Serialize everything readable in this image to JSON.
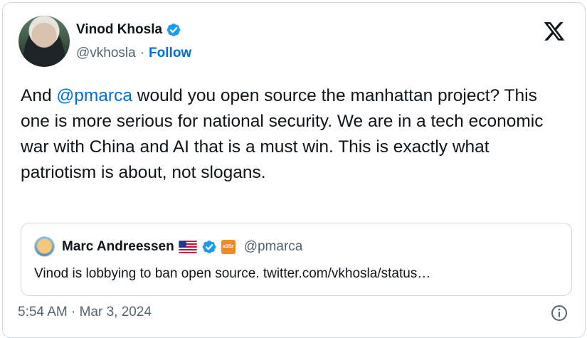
{
  "author": {
    "name": "Vinod Khosla",
    "handle": "@vkhosla",
    "separator": "·",
    "follow_label": "Follow"
  },
  "tweet": {
    "text_before": "And ",
    "mention": "@pmarca",
    "text_after": " would you open source the manhattan project? This one is more serious for national security. We are in a tech economic war with China and AI that is a must win. This is exactly what patriotism is about, not slogans."
  },
  "quoted": {
    "name": "Marc Andreessen",
    "affiliate_badge": "a16z",
    "handle": "@pmarca",
    "text": "Vinod is lobbying to ban open source. twitter.com/vkhosla/status…"
  },
  "footer": {
    "timestamp": "5:54 AM · Mar 3, 2024"
  },
  "icons": [
    "verified-badge-icon",
    "x-logo-icon",
    "us-flag-icon",
    "info-icon"
  ],
  "colors": {
    "link": "#006fd6",
    "verified": "#1d9bf0",
    "secondary_text": "#536471",
    "border": "#cfd9de"
  }
}
